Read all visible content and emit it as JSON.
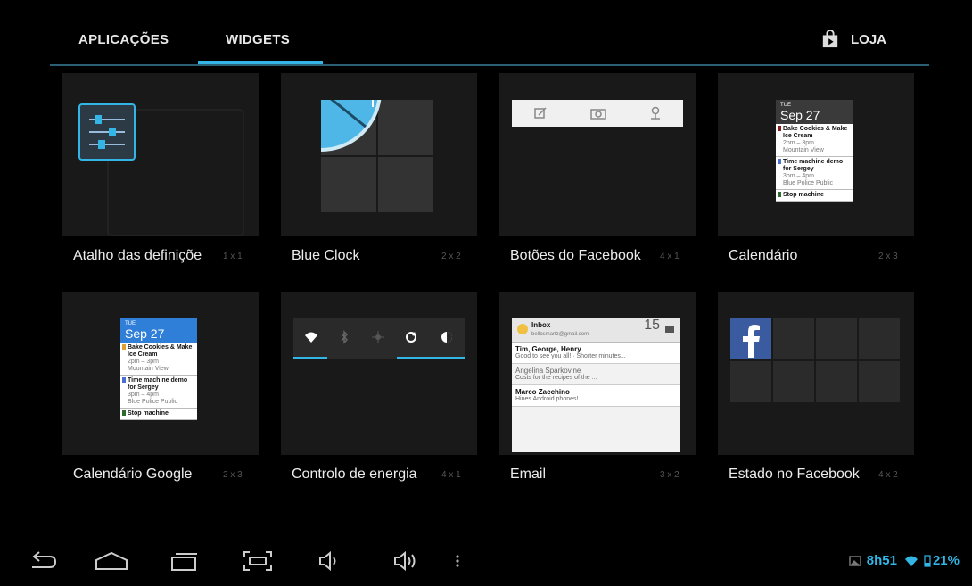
{
  "tabs": {
    "apps": "APLICAÇÕES",
    "widgets": "WIDGETS",
    "store": "LOJA"
  },
  "widgets": [
    {
      "name": "Atalho das definiçõe",
      "size": "1 x 1"
    },
    {
      "name": "Blue Clock",
      "size": "2 x 2"
    },
    {
      "name": "Botões do Facebook",
      "size": "4 x 1"
    },
    {
      "name": "Calendário",
      "size": "2 x 3"
    },
    {
      "name": "Calendário Google",
      "size": "2 x 3"
    },
    {
      "name": "Controlo de energia",
      "size": "4 x 1"
    },
    {
      "name": "Email",
      "size": "3 x 2"
    },
    {
      "name": "Estado no Facebook",
      "size": "4 x 2"
    }
  ],
  "calendar_preview": {
    "dow": "TUE",
    "date": "Sep 27",
    "events": [
      {
        "title": "Bake Cookies & Make Ice Cream",
        "time": "2pm – 3pm",
        "place": "Mountain View",
        "color": "#8b1a1a"
      },
      {
        "title": "Time machine demo for Sergey",
        "time": "3pm – 4pm",
        "place": "Blue Police Public",
        "color": "#4a6fd0"
      },
      {
        "title": "Stop machine",
        "time": "",
        "place": "",
        "color": "#2f6b2f"
      }
    ]
  },
  "email_preview": {
    "folder": "Inbox",
    "account": "bellosmartz@gmail.com",
    "count": "15",
    "messages": [
      {
        "from": "Tim, George, Henry",
        "snippet": "Good to see you all! · Shorter minutes..."
      },
      {
        "from": "Angelina Sparkovine",
        "snippet": "Costs for the recipes of the ..."
      },
      {
        "from": "Marco Zacchino",
        "snippet": "Hines Android phones! · ..."
      }
    ]
  },
  "status_bar": {
    "time": "8h51",
    "battery": "21%"
  },
  "colors": {
    "accent": "#33b5e5",
    "tile_bg": "#191919"
  }
}
